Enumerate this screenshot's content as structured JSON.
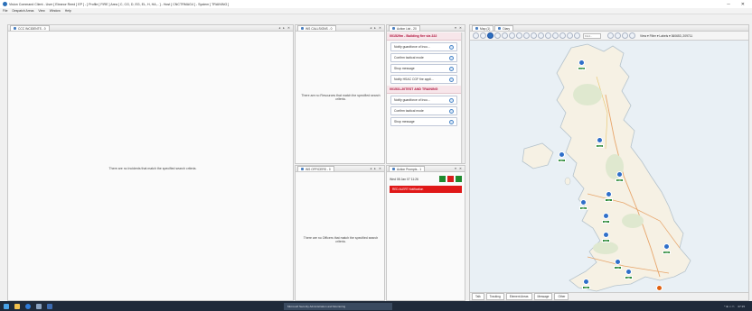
{
  "window": {
    "title": "Vision Command Client - User [ Eleanor Reed ] EP [ - ] Profile [ FIRE ] Area [ C, CG, D, EG, EL, H, HA,.. ] - Host [ CNCTRMAG4 ] - System [ TRAINING ]",
    "minimize": "─",
    "close": "✕"
  },
  "menu": [
    "File",
    "Despatch Areas",
    "View",
    "Window",
    "Help"
  ],
  "incidents_panel": {
    "tab": "CCC INCIDENTS - 0",
    "ctrls": "◂ ▸ ✕",
    "empty": "There are no Incidents that match the specified search criteria."
  },
  "callsigns_panel": {
    "tab": "WS CALLSIGNS - 0",
    "ctrls": "◂ ▸ ✕",
    "empty": "There are no Resources that match the specified search criteria."
  },
  "officers_panel": {
    "tab": "WS OFFICERS - 0",
    "ctrls": "◂ ▸ ✕",
    "empty": "There are no Officers that match the specified search criteria."
  },
  "action_list": {
    "tab": "Action List - 20",
    "ctrls": "▾ ✕",
    "groups": [
      {
        "title": "001529m - Building fire via 222",
        "items": [
          "Notify guardforce of Inco...",
          "Confirm tactical mode",
          "Shop message",
          "Notify HSAC CGF fire appli..."
        ]
      },
      {
        "title": "001531-20TEST AND TRAINING",
        "items": [
          "Notify guardforce of Inco...",
          "Confirm tactical mode",
          "Shop message"
        ]
      }
    ]
  },
  "action_prompts": {
    "tab": "Action Prompts - 1",
    "ctrls": "▾ ✕",
    "prompt_time": "Wed 08 Jan 07 11:26",
    "alert": "RED ALERT Notification"
  },
  "map_panel": {
    "tab_map": "Map (1)",
    "tab_diary": "Diary",
    "search_placeholder": "Find...",
    "right_text": "View ▾   Filter ▾   Labels ▾   360653, 209711",
    "bottom_tabs": [
      "Talk",
      "Tracking",
      "Element Areas",
      "Message",
      "Other"
    ],
    "markers": [
      {
        "label": "DCWS"
      },
      {
        "label": "CRG3"
      },
      {
        "label": "NUC"
      },
      {
        "label": "ESS"
      },
      {
        "label": "CH"
      },
      {
        "label": "WA1"
      },
      {
        "label": "BRC"
      },
      {
        "label": "EX4"
      },
      {
        "label": "LEN"
      },
      {
        "label": "LUF"
      },
      {
        "label": "BAT"
      },
      {
        "label": "CRD"
      },
      {
        "label": "FIRE"
      }
    ]
  },
  "taskbar": {
    "window_label": "Microsoft Security Administration and Monitoring",
    "time": "07:15",
    "tray": "^ ⊕ ♫ ▭"
  },
  "colors": {
    "accent": "#2c6fc0",
    "alert_red": "#e01818",
    "marker_green": "#2e8b3a",
    "prompt_red": "#d81c1c",
    "prompt_green": "#1f8a2e"
  }
}
